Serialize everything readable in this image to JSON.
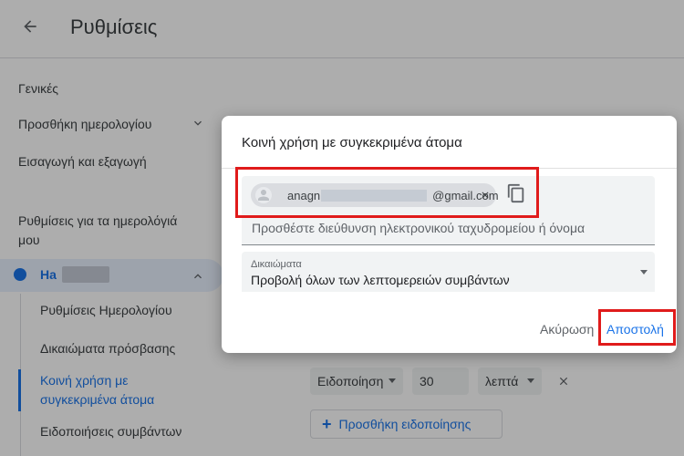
{
  "header": {
    "title": "Ρυθμίσεις"
  },
  "sidebar": {
    "items": [
      {
        "label": "Γενικές"
      },
      {
        "label": "Προσθήκη ημερολογίου"
      },
      {
        "label": "Εισαγωγή και εξαγωγή"
      }
    ],
    "section_heading": "Ρυθμίσεις για τα ημερολόγιά μου",
    "calendar": {
      "name": "Ha",
      "color": "#1a73e8"
    },
    "sub_items": [
      {
        "label": "Ρυθμίσεις Ημερολογίου"
      },
      {
        "label": "Δικαιώματα πρόσβασης"
      },
      {
        "label": "Κοινή χρήση με συγκεκριμένα άτομα"
      },
      {
        "label": "Ειδοποιήσεις συμβάντων"
      }
    ]
  },
  "background": {
    "notification_type": "Ειδοποίηση",
    "notification_amount": "30",
    "notification_unit": "λεπτά",
    "add_notification": "Προσθήκη ειδοποίησης"
  },
  "dialog": {
    "title": "Κοινή χρήση με συγκεκριμένα άτομα",
    "chip_email_prefix": "anagn",
    "chip_email_suffix": "@gmail.com",
    "add_placeholder": "Προσθέστε διεύθυνση ηλεκτρονικού ταχυδρομείου ή όνομα",
    "permissions_label": "Δικαιώματα",
    "permissions_value": "Προβολή όλων των λεπτομερειών συμβάντων",
    "cancel": "Ακύρωση",
    "send": "Αποστολή"
  },
  "colors": {
    "accent": "#1a73e8",
    "highlight": "#e01b1b"
  }
}
